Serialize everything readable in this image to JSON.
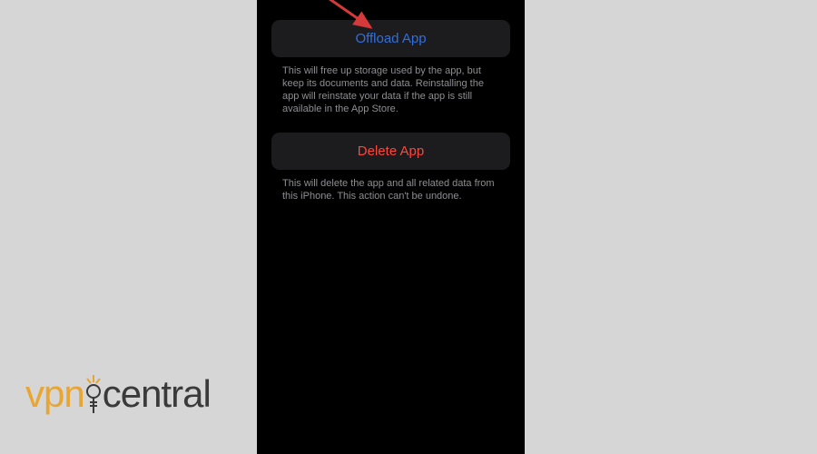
{
  "settings": {
    "offload": {
      "label": "Offload App",
      "description": "This will free up storage used by the app, but keep its documents and data. Reinstalling the app will reinstate your data if the app is still available in the App Store."
    },
    "delete": {
      "label": "Delete App",
      "description": "This will delete the app and all related data from this iPhone. This action can't be undone."
    }
  },
  "watermark": {
    "left": "vpn",
    "right": "central"
  },
  "colors": {
    "accent_blue": "#2f6fe0",
    "accent_red": "#ff453a",
    "card_bg": "#1c1c1e",
    "desc_text": "#8e8e93",
    "arrow": "#d43a3a",
    "brand_orange": "#e8a532",
    "brand_gray": "#3a3a3a"
  }
}
